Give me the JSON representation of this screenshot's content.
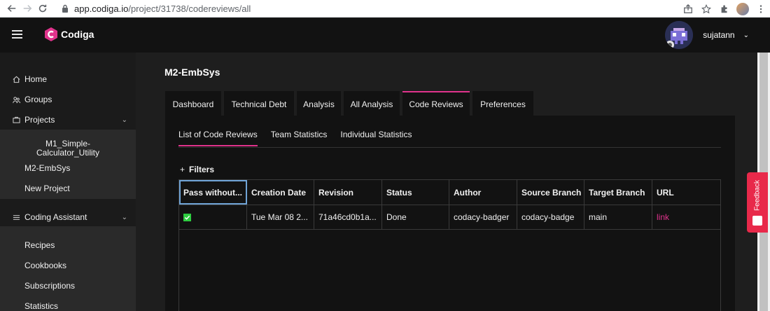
{
  "browser": {
    "url_host": "app.codiga.io",
    "url_path": "/project/31738/codereviews/all"
  },
  "header": {
    "brand": "Codiga",
    "username": "sujatann"
  },
  "sidebar": {
    "items": [
      {
        "label": "Home",
        "icon": "home-icon"
      },
      {
        "label": "Groups",
        "icon": "groups-icon"
      },
      {
        "label": "Projects",
        "icon": "projects-icon"
      }
    ],
    "projects": [
      "M1_Simple-\nCalculator_Utility",
      "M2-EmbSys",
      "New Project"
    ],
    "assistant_label": "Coding Assistant",
    "assistant_items": [
      "Recipes",
      "Cookbooks",
      "Subscriptions",
      "Statistics"
    ]
  },
  "main": {
    "project_title": "M2-EmbSys",
    "tabs": [
      {
        "label": "Dashboard"
      },
      {
        "label": "Technical Debt"
      },
      {
        "label": "Analysis"
      },
      {
        "label": "All Analysis"
      },
      {
        "label": "Code Reviews",
        "active": true
      },
      {
        "label": "Preferences"
      }
    ],
    "subtabs": [
      {
        "label": "List of Code Reviews",
        "active": true
      },
      {
        "label": "Team Statistics"
      },
      {
        "label": "Individual Statistics"
      }
    ],
    "filters_label": "Filters",
    "table": {
      "columns": [
        "Pass without...",
        "Creation Date",
        "Revision",
        "Status",
        "Author",
        "Source Branch",
        "Target Branch",
        "URL"
      ],
      "rows": [
        {
          "pass": true,
          "creation_date": "Tue Mar 08 2...",
          "revision": "71a46cd0b1a...",
          "status": "Done",
          "author": "codacy-badger",
          "source_branch": "codacy-badge",
          "target_branch": "main",
          "url": "link"
        }
      ]
    }
  },
  "feedback_label": "Feedback",
  "colors": {
    "accent": "#e0338c",
    "feedback": "#e8294a",
    "check": "#2ecc40"
  }
}
